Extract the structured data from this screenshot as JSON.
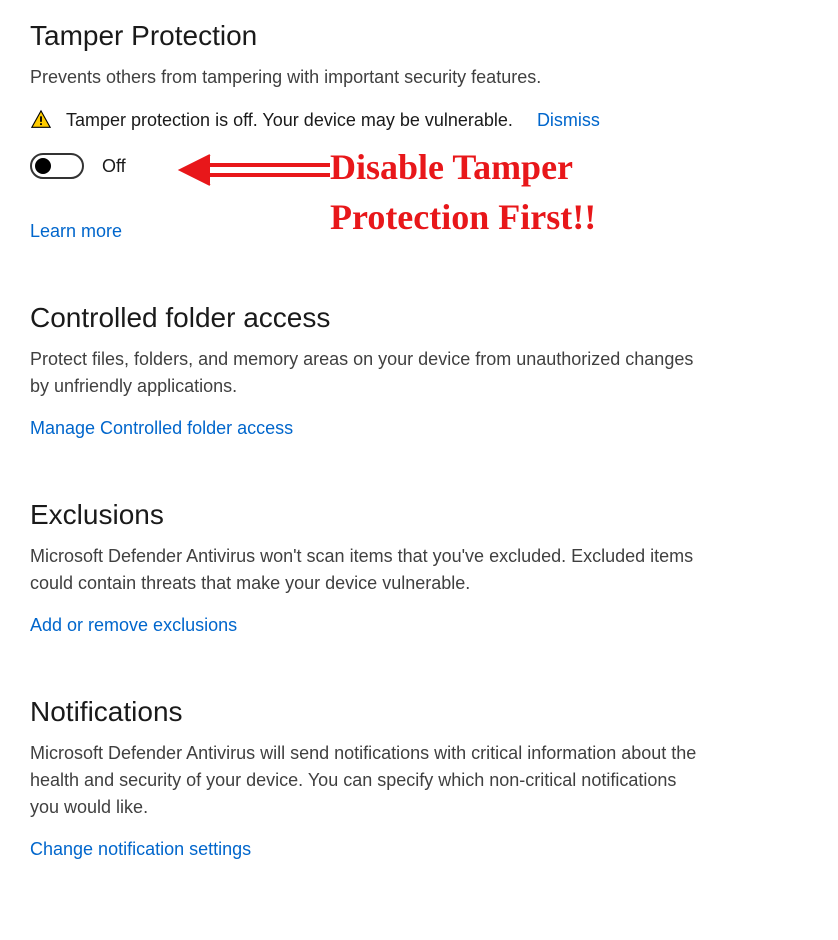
{
  "tamperProtection": {
    "title": "Tamper Protection",
    "description": "Prevents others from tampering with important security features.",
    "warningText": "Tamper protection is off. Your device may be vulnerable.",
    "dismissLabel": "Dismiss",
    "toggleState": "Off",
    "learnMoreLabel": "Learn more"
  },
  "controlledFolder": {
    "title": "Controlled folder access",
    "description": "Protect files, folders, and memory areas on your device from unauthorized changes by unfriendly applications.",
    "linkLabel": "Manage Controlled folder access"
  },
  "exclusions": {
    "title": "Exclusions",
    "description": "Microsoft Defender Antivirus won't scan items that you've excluded. Excluded items could contain threats that make your device vulnerable.",
    "linkLabel": "Add or remove exclusions"
  },
  "notifications": {
    "title": "Notifications",
    "description": "Microsoft Defender Antivirus will send notifications with critical information about the health and security of your device. You can specify which non-critical notifications you would like.",
    "linkLabel": "Change notification settings"
  },
  "annotation": {
    "text": "Disable Tamper\nProtection First!!",
    "color": "#e8171a"
  }
}
